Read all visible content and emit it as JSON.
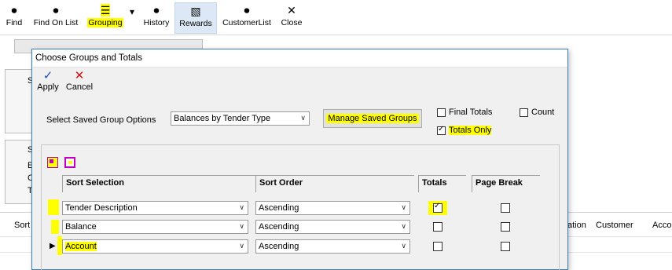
{
  "toolbar": {
    "buttons": [
      {
        "label": "Find",
        "icon": "binoculars-icon"
      },
      {
        "label": "Find On List",
        "icon": "binoculars-icon"
      },
      {
        "label": "Grouping",
        "icon": "grouping-icon"
      },
      {
        "label": "History",
        "icon": "binoculars-icon"
      },
      {
        "label": "Rewards",
        "icon": "rewards-icon"
      },
      {
        "label": "CustomerList",
        "icon": "binoculars-icon"
      },
      {
        "label": "Close",
        "icon": "close-icon"
      }
    ],
    "dropdown_glyph": "▾"
  },
  "background": {
    "left_labels": [
      "S",
      "S",
      "E",
      "C",
      "T"
    ],
    "grid_columns": [
      "Sort",
      "ation",
      "Customer",
      "Acco"
    ]
  },
  "dialog": {
    "title": "Choose Groups and Totals",
    "actions": [
      {
        "label": "Apply",
        "icon": "checkmark-icon",
        "glyph": "✓",
        "color": "#1f4fbf"
      },
      {
        "label": "Cancel",
        "icon": "cancel-icon",
        "glyph": "✕",
        "color": "#d01010"
      }
    ],
    "saved_group_label": "Select Saved Group Options",
    "saved_group_value": "Balances by Tender Type",
    "manage_button": "Manage Saved Groups",
    "options": {
      "final_totals": {
        "label": "Final Totals",
        "checked": false
      },
      "count": {
        "label": "Count",
        "checked": false
      },
      "totals_only": {
        "label": "Totals Only",
        "checked": true
      }
    },
    "grid": {
      "headers": [
        "Sort Selection",
        "Sort Order",
        "Totals",
        "Page Break"
      ],
      "rows": [
        {
          "selection": "Tender Description",
          "order": "Ascending",
          "totals": true,
          "page_break": false,
          "current": false
        },
        {
          "selection": "Balance",
          "order": "Ascending",
          "totals": false,
          "page_break": false,
          "current": false
        },
        {
          "selection": "Account",
          "order": "Ascending",
          "totals": false,
          "page_break": false,
          "current": true
        }
      ]
    }
  },
  "colors": {
    "highlight": "#ffff00",
    "dialog_border": "#3c7fb1",
    "selected_tool": "#dce8f5"
  }
}
